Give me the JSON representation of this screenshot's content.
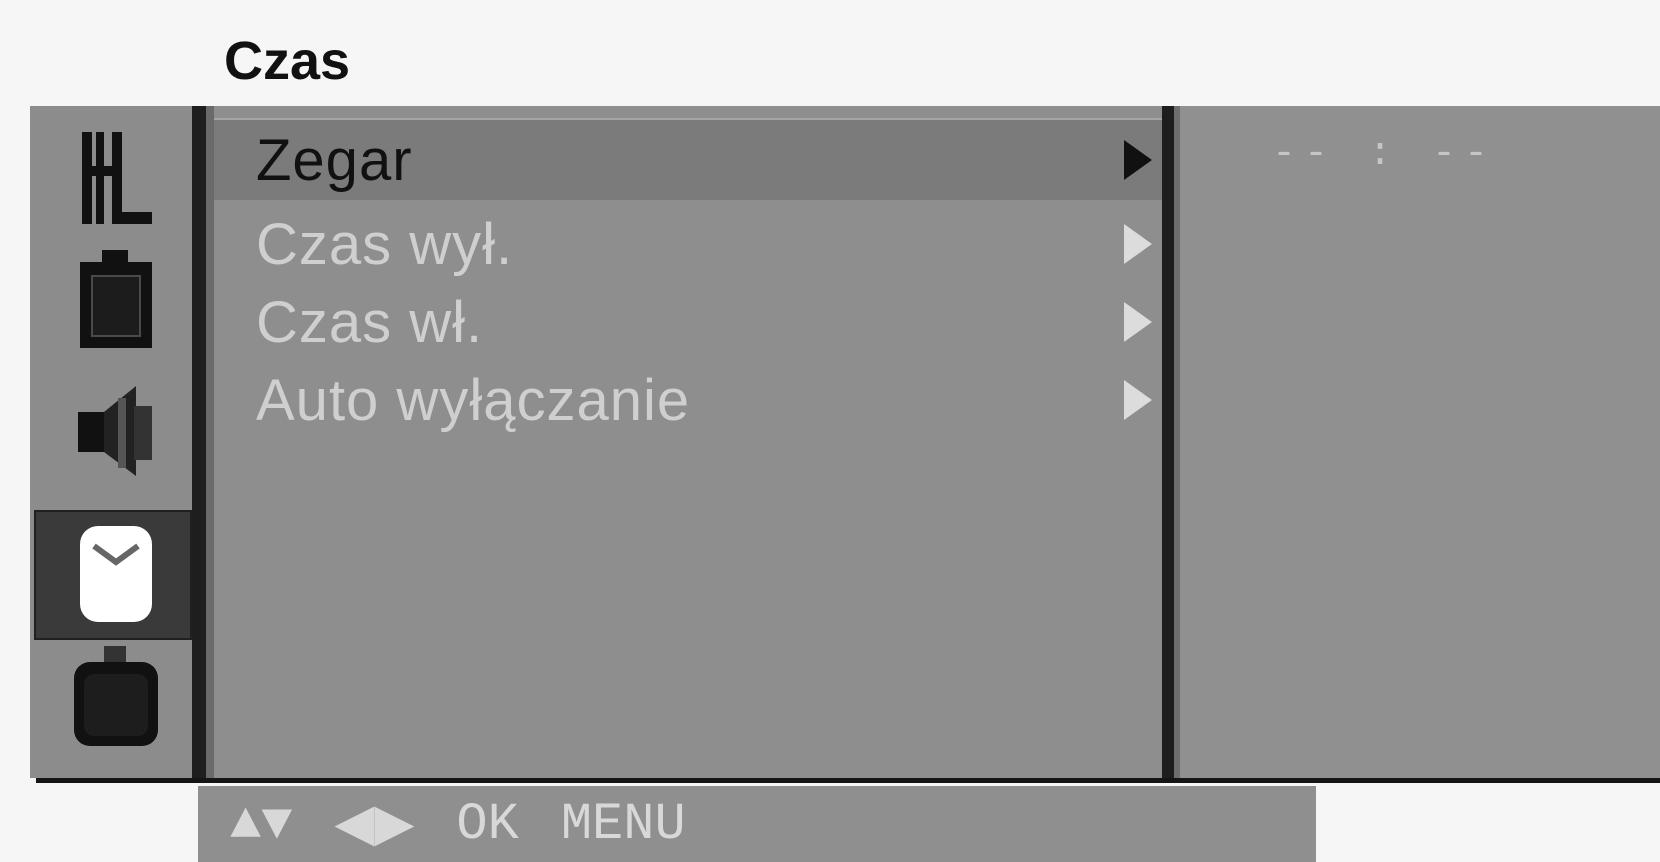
{
  "title": "Czas",
  "menu": {
    "items": [
      {
        "label": "Zegar",
        "state": "selected"
      },
      {
        "label": "Czas  wył.",
        "state": "dim"
      },
      {
        "label": "Czas  wł.",
        "state": "dim"
      },
      {
        "label": "Auto  wyłączanie",
        "state": "dim"
      }
    ]
  },
  "sidebar_icons": [
    {
      "name": "channel-icon",
      "selected": false
    },
    {
      "name": "picture-icon",
      "selected": false
    },
    {
      "name": "sound-icon",
      "selected": false
    },
    {
      "name": "time-icon",
      "selected": true
    },
    {
      "name": "special-icon",
      "selected": false
    }
  ],
  "detail": {
    "clock_value": "-- : --"
  },
  "hint_bar": {
    "navigate_glyph": "▲▼",
    "adjust_glyph": "◀▶",
    "ok_label": "OK",
    "menu_label": "MENU"
  },
  "colors": {
    "osd_background": "#8e8e8e",
    "selected_row": "#7b7b7b",
    "divider": "#1e1e1e",
    "dim_text": "#cfcfcf"
  }
}
